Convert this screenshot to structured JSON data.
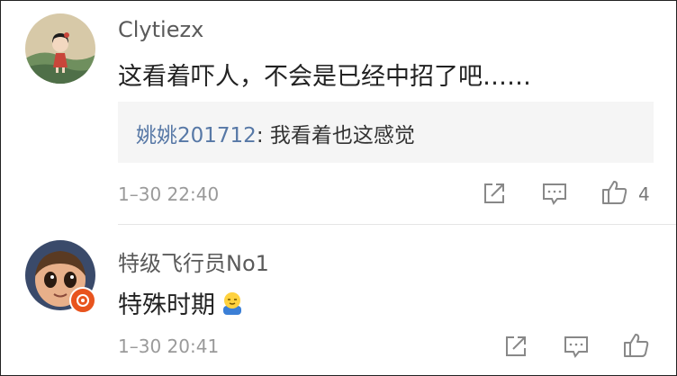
{
  "comments": [
    {
      "username": "Clytiezx",
      "text": "这看着吓人，不会是已经中招了吧……",
      "reply": {
        "user": "姚姚201712",
        "separator": ": ",
        "text": "我看着也这感觉"
      },
      "time": "1–30 22:40",
      "like_count": "4"
    },
    {
      "username": "特级飞行员No1",
      "text": "特殊时期",
      "time": "1–30 20:41",
      "like_count": ""
    }
  ],
  "icons": {
    "share": "share-icon",
    "comment": "comment-icon",
    "like": "thumbs-up-icon",
    "emoji": "emoji-icon",
    "badge": "verified-badge-icon"
  },
  "colors": {
    "link": "#5778a6",
    "badge": "#e8541e",
    "text": "#222222",
    "meta": "#9a9a9a"
  }
}
